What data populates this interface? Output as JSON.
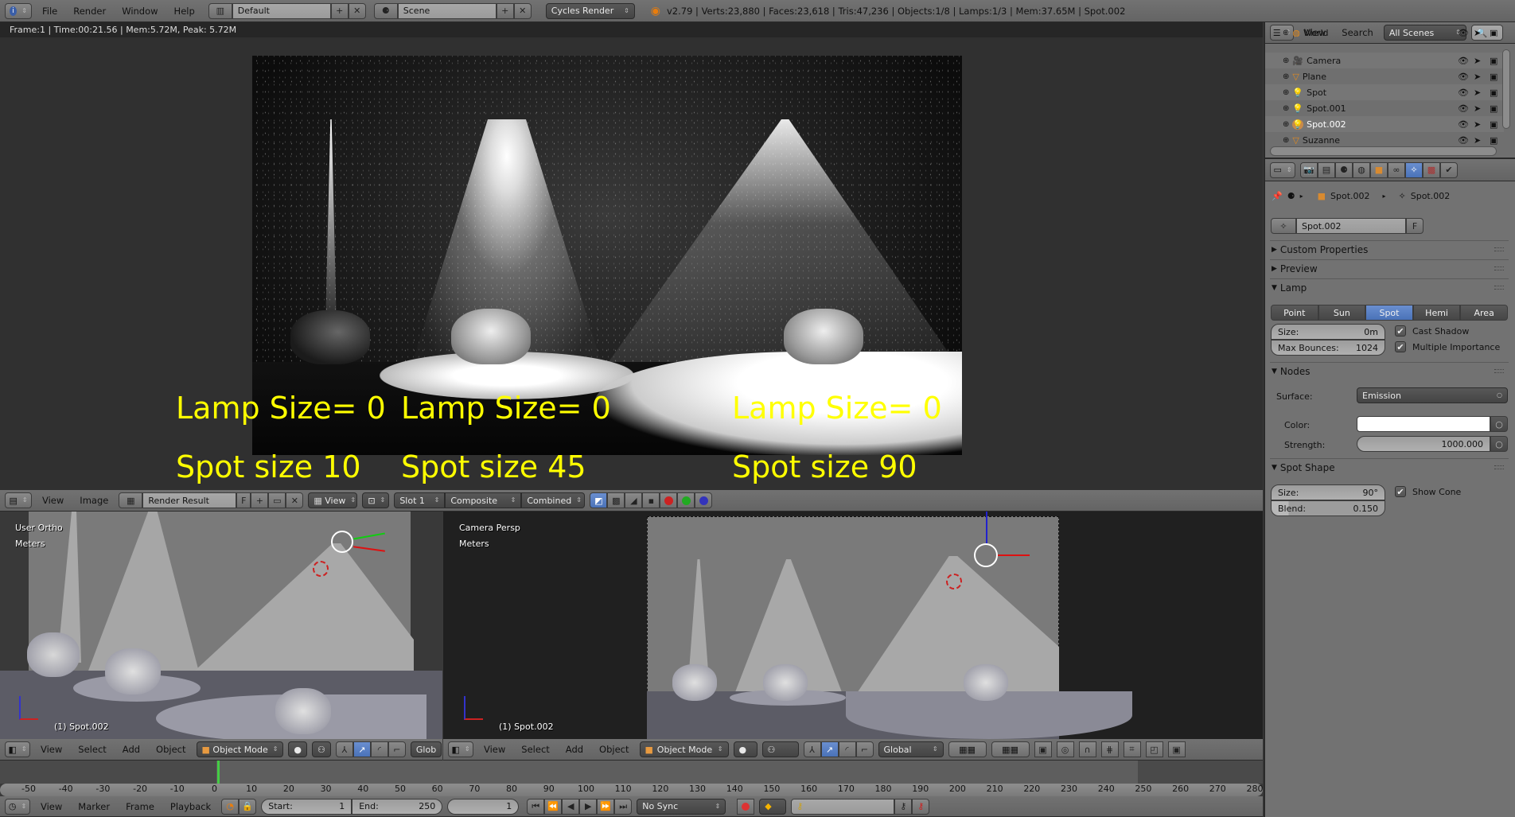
{
  "topbar": {
    "menus": [
      "File",
      "Render",
      "Window",
      "Help"
    ],
    "screen_layout": "Default",
    "scene": "Scene",
    "render_engine": "Cycles Render",
    "stats": "v2.79 | Verts:23,880 | Faces:23,618 | Tris:47,236 | Objects:1/8 | Lamps:1/3 | Mem:37.65M | Spot.002"
  },
  "image_editor": {
    "render_info": "Frame:1 | Time:00:21.56 | Mem:5.72M, Peak: 5.72M",
    "overlay_labels": [
      {
        "lamp": "Lamp Size= 0",
        "spot": "Spot size 10"
      },
      {
        "lamp": "Lamp Size= 0",
        "spot": "Spot size 45"
      },
      {
        "lamp": "Lamp Size= 0",
        "spot": "Spot size 90"
      }
    ],
    "header": {
      "menus": [
        "View",
        "Image"
      ],
      "image_name": "Render Result",
      "fake_user": "F",
      "view_label": "View",
      "slot": "Slot 1",
      "layer": "Composite",
      "pass": "Combined"
    }
  },
  "viewport_left": {
    "view_name": "User Ortho",
    "units": "Meters",
    "active_object": "(1) Spot.002",
    "header": {
      "menus": [
        "View",
        "Select",
        "Add",
        "Object"
      ],
      "mode": "Object Mode",
      "orientation": "Glob"
    }
  },
  "viewport_right": {
    "view_name": "Camera Persp",
    "units": "Meters",
    "active_object": "(1) Spot.002",
    "header": {
      "menus": [
        "View",
        "Select",
        "Add",
        "Object"
      ],
      "mode": "Object Mode",
      "orientation": "Global"
    }
  },
  "timeline": {
    "ruler_ticks": [
      "-50",
      "-40",
      "-30",
      "-20",
      "-10",
      "0",
      "10",
      "20",
      "30",
      "40",
      "50",
      "60",
      "70",
      "80",
      "90",
      "100",
      "110",
      "120",
      "130",
      "140",
      "150",
      "160",
      "170",
      "180",
      "190",
      "200",
      "210",
      "220",
      "230",
      "240",
      "250",
      "260",
      "270",
      "280"
    ],
    "current_frame_marker": 1,
    "menus": [
      "View",
      "Marker",
      "Frame",
      "Playback"
    ],
    "start_label": "Start:",
    "start_value": "1",
    "end_label": "End:",
    "end_value": "250",
    "current_frame": "1",
    "sync_mode": "No Sync"
  },
  "outliner": {
    "menus": [
      "View",
      "Search"
    ],
    "filter": "All Scenes",
    "items": [
      {
        "name": "World",
        "type": "world"
      },
      {
        "name": "Camera",
        "type": "camera"
      },
      {
        "name": "Plane",
        "type": "mesh"
      },
      {
        "name": "Spot",
        "type": "lamp"
      },
      {
        "name": "Spot.001",
        "type": "lamp"
      },
      {
        "name": "Spot.002",
        "type": "lamp",
        "selected": true
      },
      {
        "name": "Suzanne",
        "type": "mesh"
      }
    ]
  },
  "properties": {
    "breadcrumb": [
      "Spot.002",
      "Spot.002"
    ],
    "datablock_name": "Spot.002",
    "fake_user": "F",
    "panels": {
      "custom_properties": "Custom Properties",
      "preview": "Preview",
      "lamp": "Lamp",
      "nodes": "Nodes",
      "spot_shape": "Spot Shape"
    },
    "lamp_types": [
      "Point",
      "Sun",
      "Spot",
      "Hemi",
      "Area"
    ],
    "active_lamp_type": "Spot",
    "size_label": "Size:",
    "size_value": "0m",
    "max_bounces_label": "Max Bounces:",
    "max_bounces_value": "1024",
    "cast_shadow": "Cast Shadow",
    "multiple_importance": "Multiple Importance",
    "surface_label": "Surface:",
    "surface_value": "Emission",
    "color_label": "Color:",
    "color_value": "#ffffff",
    "strength_label": "Strength:",
    "strength_value": "1000.000",
    "spot_size_label": "Size:",
    "spot_size_value": "90°",
    "blend_label": "Blend:",
    "blend_value": "0.150",
    "show_cone": "Show Cone"
  }
}
